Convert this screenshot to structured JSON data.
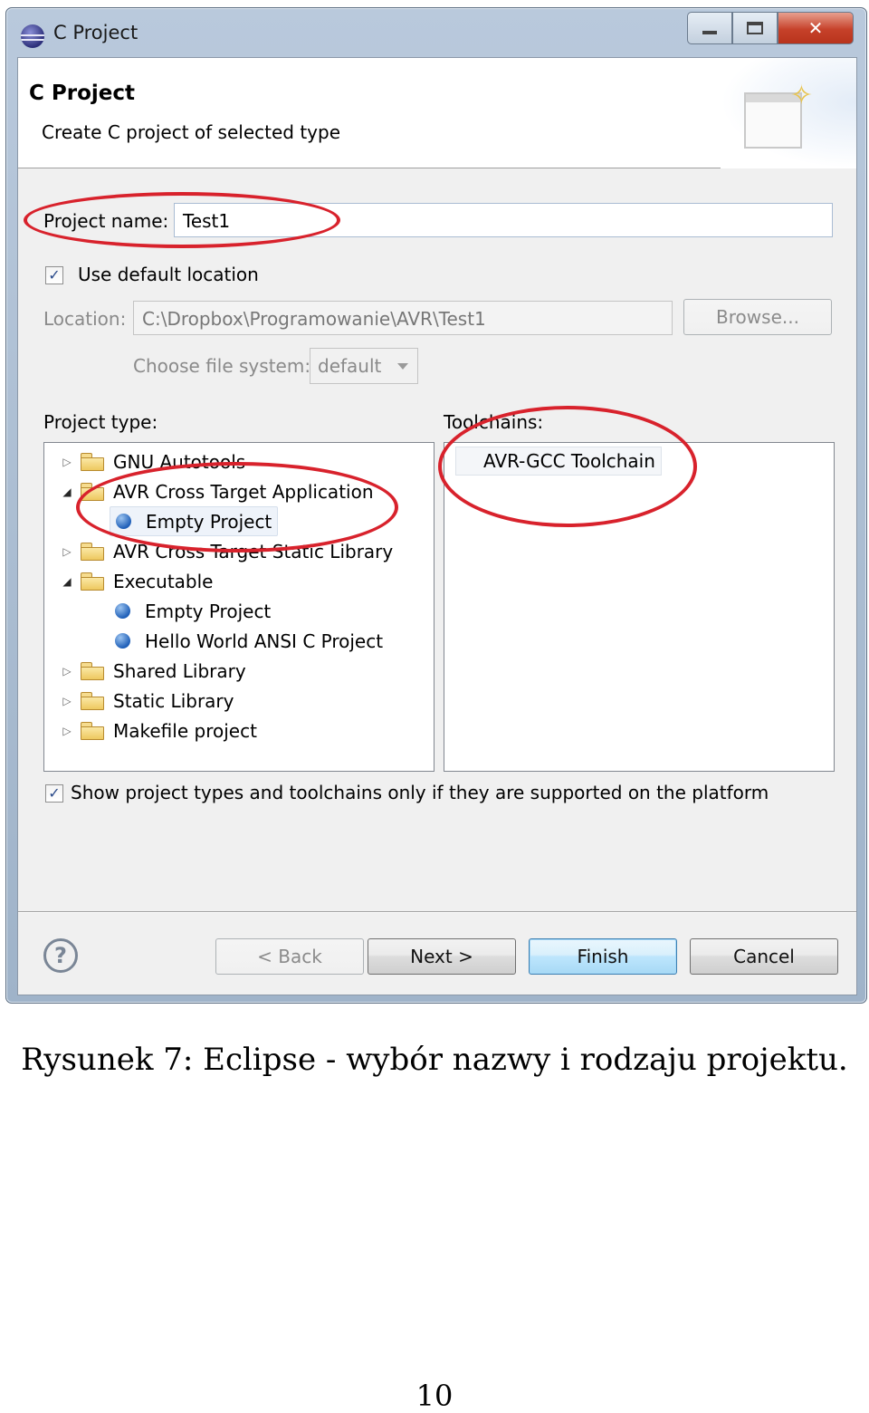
{
  "window": {
    "title": "C Project",
    "controls": {
      "minimize": "minimize",
      "maximize": "maximize",
      "close": "✕"
    }
  },
  "header": {
    "title": "C Project",
    "description": "Create C project of selected type"
  },
  "form": {
    "project_name_label": "Project name:",
    "project_name_value": "Test1",
    "use_default_location_label": "Use default location",
    "use_default_location_checked": true,
    "location_label": "Location:",
    "location_value": "C:\\Dropbox\\Programowanie\\AVR\\Test1",
    "browse_label": "Browse...",
    "file_system_label": "Choose file system:",
    "file_system_value": "default"
  },
  "project_type": {
    "label": "Project type:",
    "items": [
      {
        "label": "GNU Autotools",
        "kind": "folder",
        "expanded": false
      },
      {
        "label": "AVR Cross Target Application",
        "kind": "folder",
        "expanded": true
      },
      {
        "label": "Empty Project",
        "kind": "project",
        "selected": true
      },
      {
        "label": "AVR Cross Target Static Library",
        "kind": "folder",
        "expanded": false
      },
      {
        "label": "Executable",
        "kind": "folder",
        "expanded": true
      },
      {
        "label": "Empty Project",
        "kind": "project"
      },
      {
        "label": "Hello World ANSI C Project",
        "kind": "project"
      },
      {
        "label": "Shared Library",
        "kind": "folder",
        "expanded": false
      },
      {
        "label": "Static Library",
        "kind": "folder",
        "expanded": false
      },
      {
        "label": "Makefile project",
        "kind": "folder",
        "expanded": false
      }
    ]
  },
  "toolchains": {
    "label": "Toolchains:",
    "items": [
      "AVR-GCC Toolchain"
    ]
  },
  "show_supported_label": "Show project types and toolchains only if they are supported on the platform",
  "show_supported_checked": true,
  "buttons": {
    "help": "?",
    "back": "< Back",
    "next": "Next >",
    "finish": "Finish",
    "cancel": "Cancel"
  },
  "caption": "Rysunek 7: Eclipse - wybór nazwy i rodzaju projektu.",
  "page_number": "10",
  "icons": [
    "eclipse-app-icon",
    "wizard-banner-icon",
    "folder-icon",
    "project-dot-icon",
    "help-icon",
    "check-icon"
  ],
  "colors": {
    "annotation": "#d8222c",
    "selection": "#eef3fa",
    "default_button": "#a7d9f5"
  }
}
